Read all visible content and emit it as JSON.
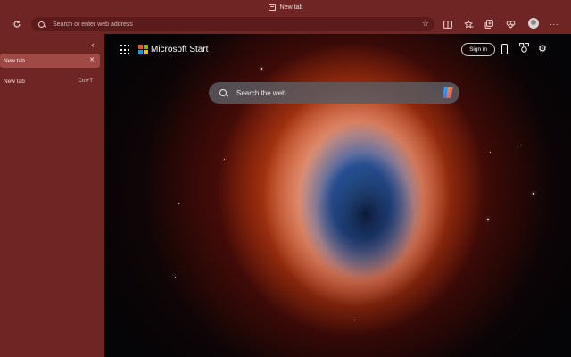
{
  "window": {
    "tab_title": "New tab"
  },
  "toolbar": {
    "address_placeholder": "Search or enter web address",
    "icons": [
      "refresh-icon",
      "favorite-star-icon",
      "split-screen-icon",
      "favorites-icon",
      "collections-icon",
      "browser-essentials-icon",
      "profile-avatar",
      "more-options-icon"
    ]
  },
  "sidebar": {
    "tabs": [
      {
        "label": "New tab",
        "active": true
      }
    ],
    "new_tab_label": "New tab",
    "new_tab_shortcut": "Ctrl+T"
  },
  "ntp": {
    "brand": "Microsoft Start",
    "sign_in": "Sign in",
    "search_placeholder": "Search the web"
  },
  "colors": {
    "frame": "#6e2523",
    "active_tab": "#a04a47",
    "address_bar": "#5a1b1a"
  }
}
